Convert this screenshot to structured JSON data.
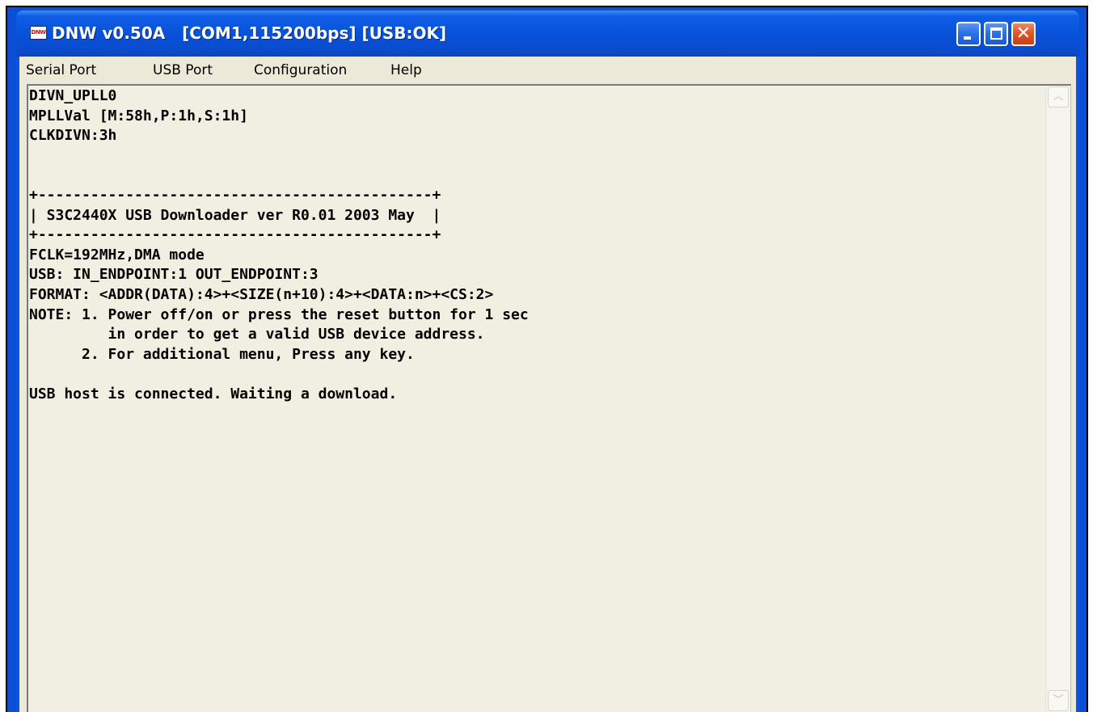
{
  "window": {
    "title": "DNW v0.50A   [COM1,115200bps] [USB:OK]",
    "icon_label": "DNW",
    "icon": "dnw-app-icon",
    "accent": "#0b55e0"
  },
  "controls": {
    "minimize_icon": "minimize-icon",
    "maximize_icon": "maximize-icon",
    "close_icon": "close-icon",
    "close_glyph": "✕"
  },
  "menu": {
    "items": [
      {
        "label": "Serial Port"
      },
      {
        "label": "USB Port"
      },
      {
        "label": "Configuration"
      },
      {
        "label": "Help"
      }
    ]
  },
  "terminal": {
    "lines": [
      "DIVN_UPLL0",
      "MPLLVal [M:58h,P:1h,S:1h]",
      "CLKDIVN:3h",
      "",
      "",
      "+---------------------------------------------+",
      "| S3C2440X USB Downloader ver R0.01 2003 May  |",
      "+---------------------------------------------+",
      "FCLK=192MHz,DMA mode",
      "USB: IN_ENDPOINT:1 OUT_ENDPOINT:3",
      "FORMAT: <ADDR(DATA):4>+<SIZE(n+10):4>+<DATA:n>+<CS:2>",
      "NOTE: 1. Power off/on or press the reset button for 1 sec",
      "         in order to get a valid USB device address.",
      "      2. For additional menu, Press any key.",
      "",
      "USB host is connected. Waiting a download."
    ]
  },
  "scrollbar": {
    "up_icon": "scroll-up-arrow-icon",
    "down_icon": "scroll-down-arrow-icon",
    "up_glyph": "︿",
    "down_glyph": "﹀"
  }
}
